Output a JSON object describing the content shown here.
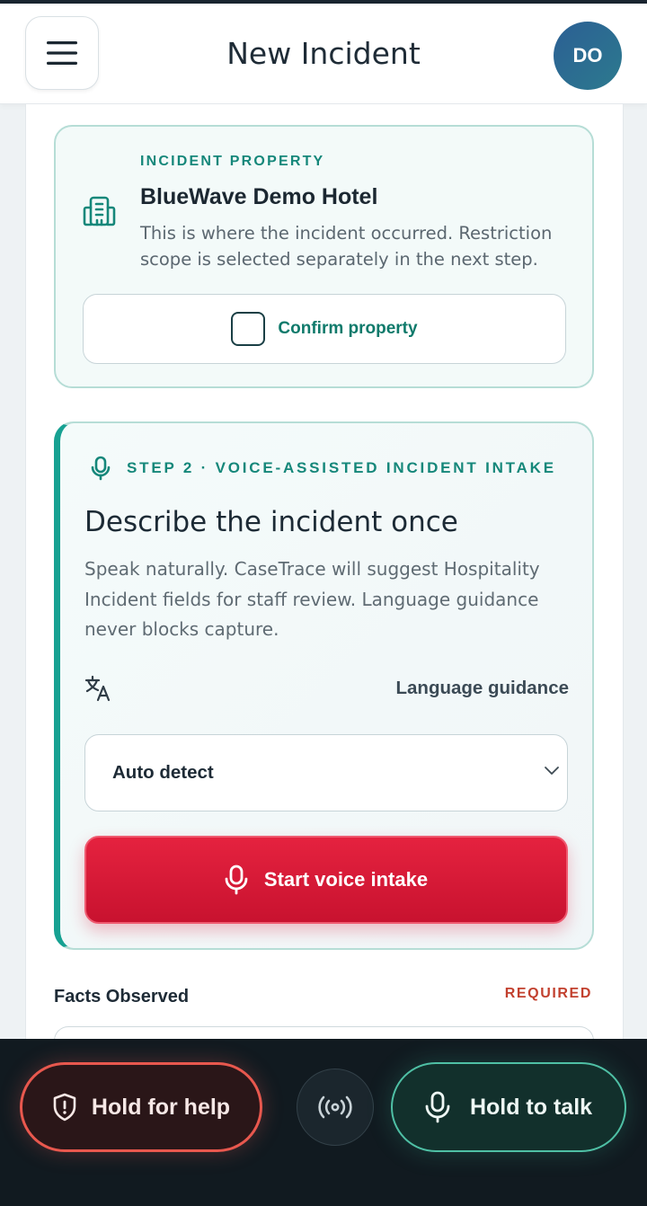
{
  "header": {
    "title": "New Incident",
    "avatar_initials": "DO",
    "menu_icon": "hamburger-menu-icon"
  },
  "property_card": {
    "eyebrow": "INCIDENT PROPERTY",
    "name": "BlueWave Demo Hotel",
    "description": "This is where the incident occurred. Restriction scope is selected separately in the next step.",
    "icon": "building-icon",
    "confirm_label": "Confirm property",
    "confirmed": false
  },
  "voice_card": {
    "step_label": "STEP 2 · VOICE-ASSISTED INCIDENT INTAKE",
    "title": "Describe the incident once",
    "description": "Speak naturally. CaseTrace will suggest Hospitality Incident fields for staff review. Language guidance never blocks capture.",
    "language_label": "Language guidance",
    "language_value": "Auto detect",
    "start_button_label": "Start voice intake"
  },
  "facts": {
    "label": "Facts Observed",
    "required_label": "REQUIRED"
  },
  "bottom_bar": {
    "help_label": "Hold for help",
    "talk_label": "Hold to talk",
    "broadcast_icon": "broadcast-icon"
  },
  "colors": {
    "accent_teal": "#15877a",
    "danger_red": "#e5223f",
    "help_outline": "#e8584e",
    "talk_outline": "#4fc0a5",
    "avatar_blue": "#2b5f94"
  }
}
